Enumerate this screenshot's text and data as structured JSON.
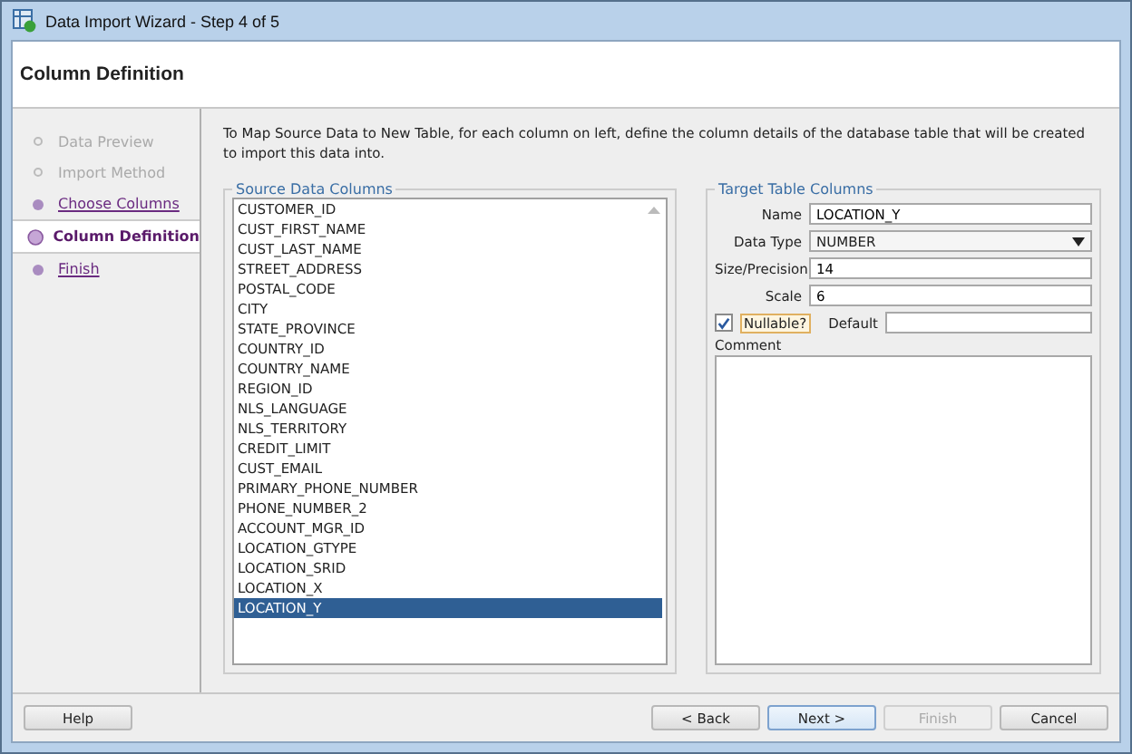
{
  "window": {
    "title": "Data Import Wizard - Step 4 of 5"
  },
  "header": {
    "title": "Column Definition"
  },
  "steps": [
    {
      "label": "Data Preview",
      "selected": false,
      "disabled": true
    },
    {
      "label": "Import Method",
      "selected": false,
      "disabled": true
    },
    {
      "label": "Choose Columns",
      "selected": false,
      "disabled": false
    },
    {
      "label": "Column Definition",
      "selected": true,
      "disabled": false
    },
    {
      "label": "Finish",
      "selected": false,
      "disabled": false
    }
  ],
  "instructions": "To Map Source Data to New Table, for each column on left, define the column details of the database table that will be created to import this data into.",
  "source": {
    "title": "Source Data Columns",
    "columns": [
      {
        "label": "CUSTOMER_ID",
        "selected": false
      },
      {
        "label": "CUST_FIRST_NAME",
        "selected": false
      },
      {
        "label": "CUST_LAST_NAME",
        "selected": false
      },
      {
        "label": "STREET_ADDRESS",
        "selected": false
      },
      {
        "label": "POSTAL_CODE",
        "selected": false
      },
      {
        "label": "CITY",
        "selected": false
      },
      {
        "label": "STATE_PROVINCE",
        "selected": false
      },
      {
        "label": "COUNTRY_ID",
        "selected": false
      },
      {
        "label": "COUNTRY_NAME",
        "selected": false
      },
      {
        "label": "REGION_ID",
        "selected": false
      },
      {
        "label": "NLS_LANGUAGE",
        "selected": false
      },
      {
        "label": "NLS_TERRITORY",
        "selected": false
      },
      {
        "label": "CREDIT_LIMIT",
        "selected": false
      },
      {
        "label": "CUST_EMAIL",
        "selected": false
      },
      {
        "label": "PRIMARY_PHONE_NUMBER",
        "selected": false
      },
      {
        "label": "PHONE_NUMBER_2",
        "selected": false
      },
      {
        "label": "ACCOUNT_MGR_ID",
        "selected": false
      },
      {
        "label": "LOCATION_GTYPE",
        "selected": false
      },
      {
        "label": "LOCATION_SRID",
        "selected": false
      },
      {
        "label": "LOCATION_X",
        "selected": false
      },
      {
        "label": "LOCATION_Y",
        "selected": true
      }
    ]
  },
  "target": {
    "title": "Target Table Columns",
    "name": {
      "label": "Name",
      "value": "LOCATION_Y"
    },
    "data_type": {
      "label": "Data Type",
      "value": "NUMBER"
    },
    "size": {
      "label": "Size/Precision",
      "value": "14"
    },
    "scale": {
      "label": "Scale",
      "value": "6"
    },
    "nullable": {
      "label": "Nullable?",
      "checked": true
    },
    "default": {
      "label": "Default"
    },
    "comment": {
      "label": "Comment"
    }
  },
  "buttons": [
    {
      "label": "Help",
      "kind": "left",
      "disabled": false
    },
    {
      "label": "< Back",
      "kind": "right",
      "disabled": false
    },
    {
      "label": "Next >",
      "kind": "default",
      "disabled": false
    },
    {
      "label": "Finish",
      "kind": "right",
      "disabled": true
    },
    {
      "label": "Cancel",
      "kind": "right",
      "disabled": false
    }
  ]
}
